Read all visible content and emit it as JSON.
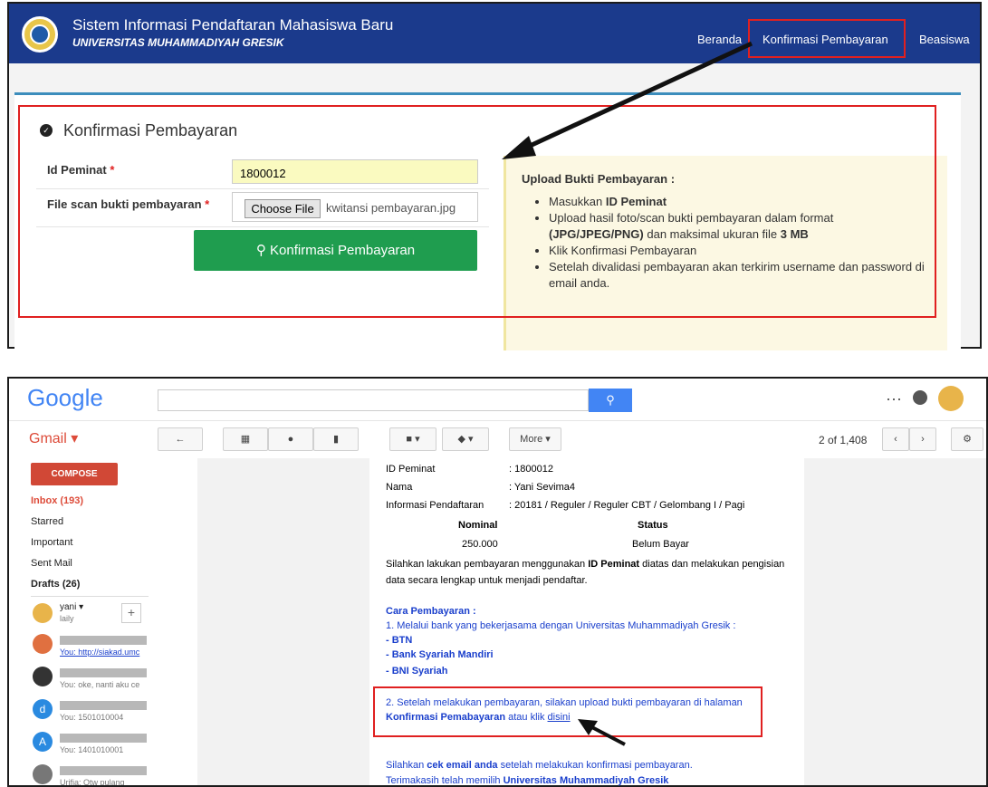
{
  "top": {
    "app_title": "Sistem Informasi Pendaftaran Mahasiswa Baru",
    "app_subtitle": "UNIVERSITAS MUHAMMADIYAH GRESIK",
    "nav": [
      "Beranda",
      "Konfirmasi Pembayaran",
      "Beasiswa"
    ],
    "form_title": "Konfirmasi Pembayaran",
    "id_label": "Id Peminat",
    "id_value": "1800012",
    "file_label": "File scan bukti pembayaran",
    "choose_label": "Choose File",
    "file_name": "kwitansi pembayaran.jpg",
    "submit_label": "Konfirmasi Pembayaran",
    "info_title": "Upload Bukti Pembayaran :",
    "info_items": [
      {
        "pre": "Masukkan ",
        "bold": "ID Peminat",
        "post": ""
      },
      {
        "pre": "Upload hasil foto/scan bukti pembayaran dalam format ",
        "bold": "(JPG/JPEG/PNG)",
        "post": " dan maksimal ukuran file ",
        "bold2": "3 MB"
      },
      {
        "pre": "Klik Konfirmasi Pembayaran",
        "bold": "",
        "post": ""
      },
      {
        "pre": "Setelah divalidasi pembayaran akan terkirim username dan password di email anda.",
        "bold": "",
        "post": ""
      }
    ],
    "required_mark": "*"
  },
  "gmail": {
    "logo": "Google",
    "app": "Gmail",
    "more_label": "More",
    "pagination": "2 of 1,408",
    "compose": "COMPOSE",
    "folders": [
      "Inbox (193)",
      "Starred",
      "Important",
      "Sent Mail",
      "Drafts (26)"
    ],
    "chat_user": "yani",
    "chat_user_sub": "laily",
    "chats": [
      "You: http://siakad.umc",
      "You: oke, nanti aku ce",
      "You: 1501010004",
      "You: 1401010001",
      "Urifia: Otw pulang"
    ],
    "chat_avatar_letters": [
      "d",
      "A"
    ],
    "mail": {
      "id_label": "ID Peminat",
      "id_value": ": 1800012",
      "nama_label": "Nama",
      "nama_value": ": Yani Sevima4",
      "info_label": "Informasi Pendaftaran",
      "info_value": ": 20181 / Reguler / Reguler CBT / Gelombang I / Pagi",
      "col_nominal": "Nominal",
      "col_status": "Status",
      "nominal": "250.000",
      "status": "Belum Bayar",
      "p1_pre": "Silahkan lakukan pembayaran menggunakan ",
      "p1_bold": "ID Peminat",
      "p1_post": " diatas dan melakukan pengisian",
      "p1_line2": "data secara lengkap untuk menjadi pendaftar.",
      "cara_title": "Cara Pembayaran :",
      "cara1": "1. Melalui bank yang bekerjasama dengan Universitas Muhammadiyah Gresik :",
      "banks": [
        "- BTN",
        "- Bank Syariah Mandiri",
        "- BNI Syariah"
      ],
      "cara2": "2. Setelah melakukan pembayaran, silakan upload bukti pembayaran di halaman",
      "cara2_bold": "Konfirmasi Pemabayaran",
      "cara2_mid": " atau klik ",
      "cara2_link": "disini",
      "foot1_pre": "Silahkan ",
      "foot1_bold": "cek email anda",
      "foot1_post": " setelah melakukan konfirmasi pembayaran.",
      "foot2_pre": "Terimakasih telah memilih ",
      "foot2_bold": "Universitas Muhammadiyah Gresik"
    }
  },
  "colors": {
    "header": "#1b3a8c",
    "highlight": "#e02020",
    "submit": "#1f9d4f",
    "link": "#1a3fcc"
  }
}
